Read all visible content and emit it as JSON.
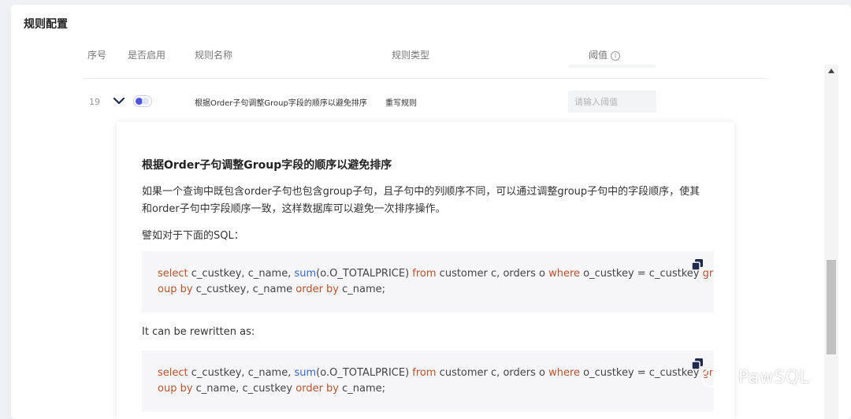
{
  "section_title": "规则配置",
  "table": {
    "headers": {
      "index": "序号",
      "enabled": "是否启用",
      "rule_name": "规则名称",
      "rule_type": "规则类型",
      "threshold": "阈值"
    },
    "row": {
      "index": "19",
      "enabled": true,
      "rule_name": "根据Order子句调整Group字段的顺序以避免排序",
      "rule_type": "重写规则",
      "threshold_value": "",
      "threshold_placeholder": "请输入阈值"
    }
  },
  "detail": {
    "title": "根据Order子句调整Group字段的顺序以避免排序",
    "paragraph_line1": "如果一个查询中既包含order子句也包含group子句，且子句中的列顺序不同，可以通过调整group子句中的字段顺序，使其",
    "paragraph_line2": "和order子句中字段顺序一致，这样数据库可以避免一次排序操作。",
    "example_intro": "譬如对于下面的SQL：",
    "code1": {
      "line1": [
        {
          "t": "select",
          "c": "kw"
        },
        {
          "t": " c_custkey, c_name, ",
          "c": ""
        },
        {
          "t": "sum",
          "c": "fn"
        },
        {
          "t": "(o.O_TOTALPRICE) ",
          "c": ""
        },
        {
          "t": "from",
          "c": "kw"
        },
        {
          "t": " customer c, orders o ",
          "c": ""
        },
        {
          "t": "where",
          "c": "kw"
        },
        {
          "t": " o_custkey = c_custkey ",
          "c": ""
        },
        {
          "t": "gr",
          "c": "kw"
        }
      ],
      "line2": [
        {
          "t": "oup by",
          "c": "kw"
        },
        {
          "t": " c_custkey, c_name ",
          "c": ""
        },
        {
          "t": "order by",
          "c": "kw"
        },
        {
          "t": " c_name;",
          "c": ""
        }
      ]
    },
    "rewrite_intro": "It can be rewritten as:",
    "code2": {
      "line1": [
        {
          "t": "select",
          "c": "kw"
        },
        {
          "t": " c_custkey, c_name, ",
          "c": ""
        },
        {
          "t": "sum",
          "c": "fn"
        },
        {
          "t": "(o.O_TOTALPRICE) ",
          "c": ""
        },
        {
          "t": "from",
          "c": "kw"
        },
        {
          "t": " customer c, orders o ",
          "c": ""
        },
        {
          "t": "where",
          "c": "kw"
        },
        {
          "t": " o_custkey = c_custkey ",
          "c": ""
        },
        {
          "t": "gr",
          "c": "kw"
        }
      ],
      "line2": [
        {
          "t": "oup by",
          "c": "kw"
        },
        {
          "t": " c_name, c_custkey ",
          "c": ""
        },
        {
          "t": "order by",
          "c": "kw"
        },
        {
          "t": " c_name;",
          "c": ""
        }
      ]
    }
  },
  "watermark": "PawSQL",
  "icons": {
    "expand": "chevron-down-icon",
    "copy": "copy-icon",
    "info": "info-icon",
    "watermark_logo": "wechat-icon"
  },
  "colors": {
    "accent": "#4a56e2",
    "sql_keyword": "#b2522e",
    "sql_function": "#3a66c9"
  }
}
